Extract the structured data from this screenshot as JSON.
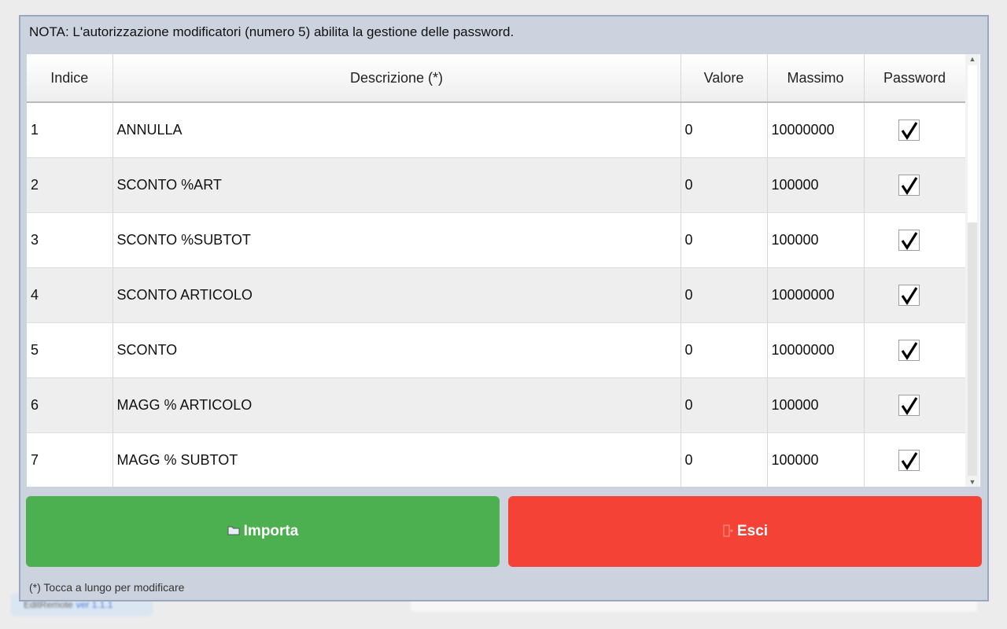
{
  "background": {
    "app_name": "EditRemote",
    "version": "ver 1.1.1"
  },
  "dialog": {
    "note": "NOTA: L'autorizzazione modificatori (numero 5) abilita la gestione delle password.",
    "columns": [
      "Indice",
      "Descrizione (*)",
      "Valore",
      "Massimo",
      "Password"
    ],
    "rows": [
      {
        "indice": "1",
        "descrizione": "ANNULLA",
        "valore": "0",
        "massimo": "10000000",
        "password": true
      },
      {
        "indice": "2",
        "descrizione": "SCONTO %ART",
        "valore": "0",
        "massimo": "100000",
        "password": true
      },
      {
        "indice": "3",
        "descrizione": "SCONTO %SUBTOT",
        "valore": "0",
        "massimo": "100000",
        "password": true
      },
      {
        "indice": "4",
        "descrizione": "SCONTO ARTICOLO",
        "valore": "0",
        "massimo": "10000000",
        "password": true
      },
      {
        "indice": "5",
        "descrizione": "SCONTO",
        "valore": "0",
        "massimo": "10000000",
        "password": true
      },
      {
        "indice": "6",
        "descrizione": "MAGG % ARTICOLO",
        "valore": "0",
        "massimo": "100000",
        "password": true
      },
      {
        "indice": "7",
        "descrizione": "MAGG % SUBTOT",
        "valore": "0",
        "massimo": "100000",
        "password": true
      }
    ],
    "buttons": {
      "import_label": "Importa",
      "import_icon": "folder-icon",
      "exit_label": "Esci",
      "exit_icon": "exit-icon",
      "import_color": "#4caf50",
      "exit_color": "#f44336"
    },
    "footnote": "(*) Tocca a lungo per modificare"
  }
}
